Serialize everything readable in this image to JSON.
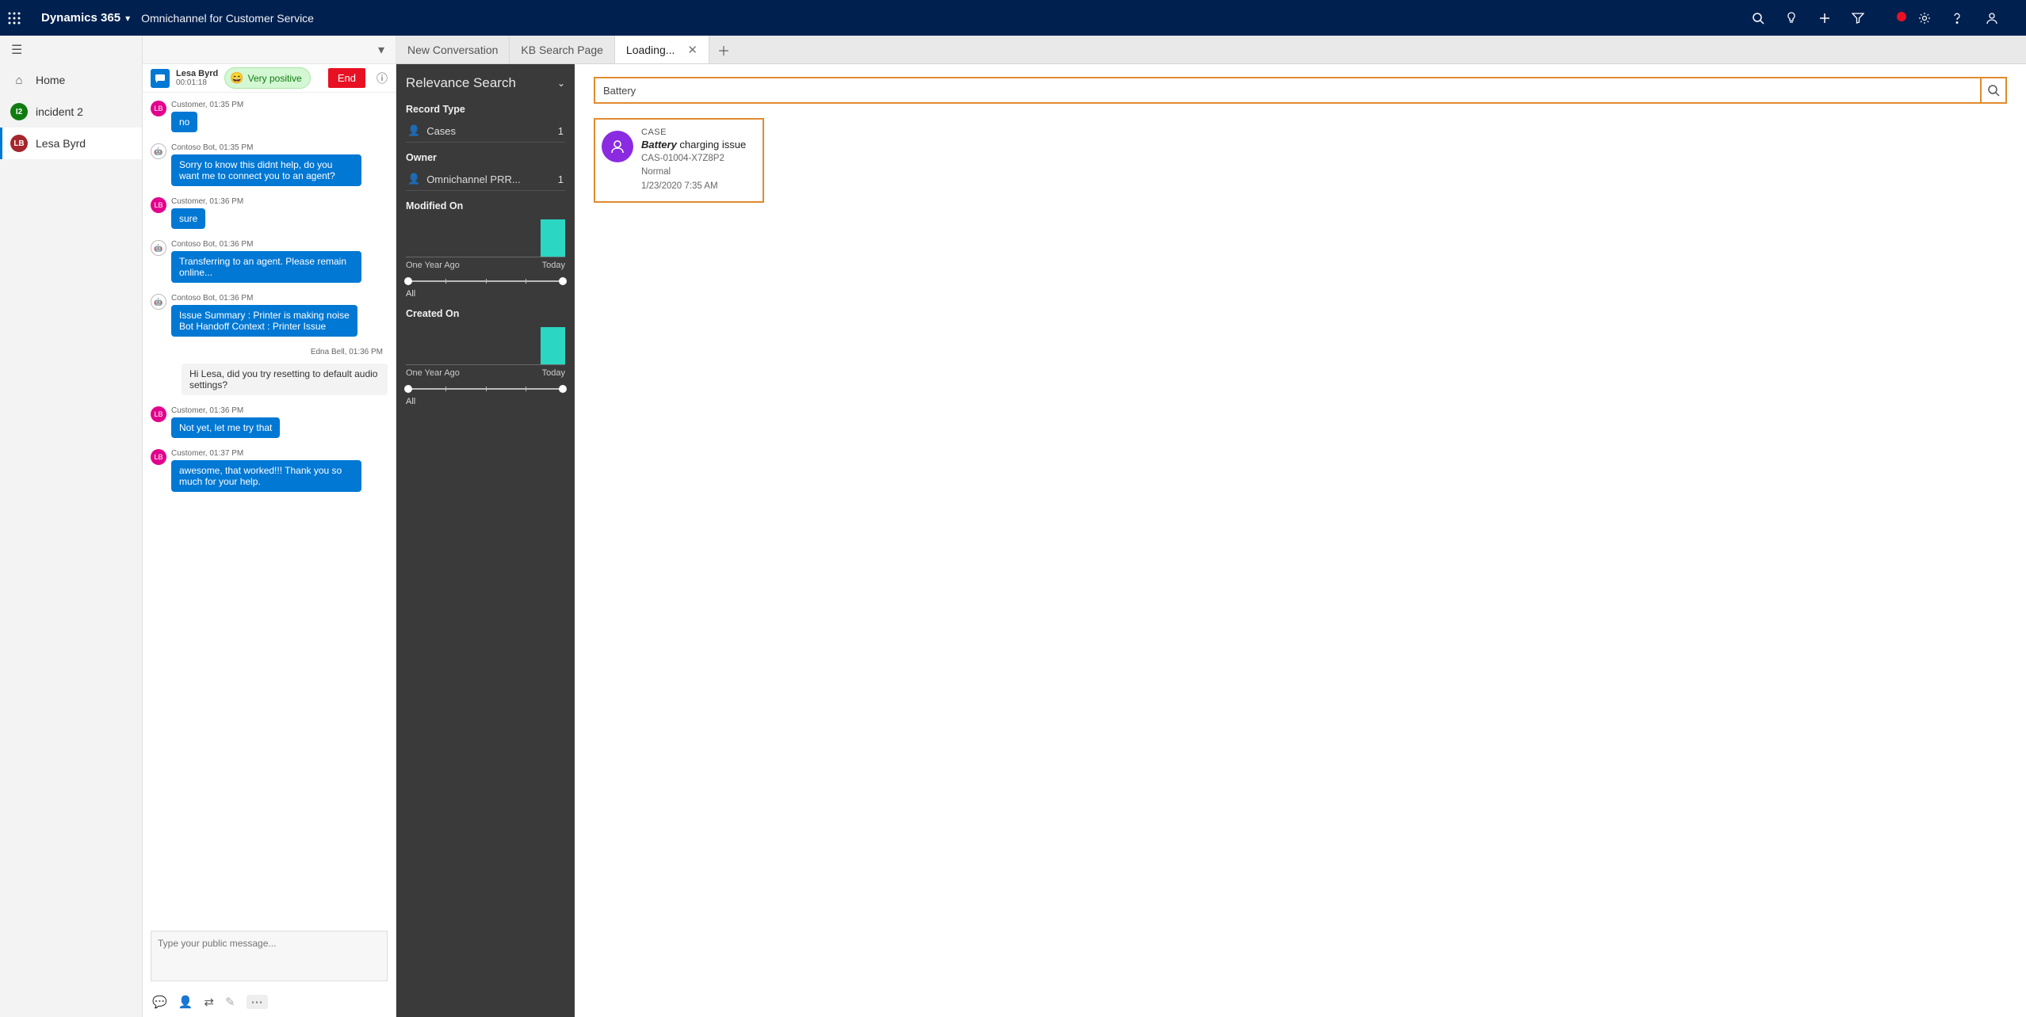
{
  "chart_data": [
    {
      "type": "bar",
      "title": "Modified On",
      "categories": [
        "",
        "",
        "",
        "",
        "",
        "Today"
      ],
      "values": [
        0,
        0,
        0,
        0,
        0,
        1
      ],
      "xmin_label": "One Year Ago",
      "xmax_label": "Today"
    },
    {
      "type": "bar",
      "title": "Created On",
      "categories": [
        "",
        "",
        "",
        "",
        "",
        "Today"
      ],
      "values": [
        0,
        0,
        0,
        0,
        0,
        1
      ],
      "xmin_label": "One Year Ago",
      "xmax_label": "Today"
    }
  ],
  "topnav": {
    "app": "Dynamics 365",
    "sub_app": "Omnichannel for Customer Service"
  },
  "leftrail": {
    "home": "Home",
    "items": [
      {
        "badge": "I2",
        "label": "incident 2"
      },
      {
        "badge": "LB",
        "label": "Lesa Byrd"
      }
    ]
  },
  "tabs": {
    "t1": "New Conversation",
    "t2": "KB Search Page",
    "t3": "Loading..."
  },
  "session": {
    "customer_name": "Lesa Byrd",
    "duration": "00:01:18",
    "sentiment": "Very positive",
    "end": "End",
    "compose_placeholder": "Type your public message...",
    "messages": [
      {
        "who": "customer",
        "meta": "Customer, 01:35 PM",
        "text": "no"
      },
      {
        "who": "bot",
        "meta": "Contoso Bot, 01:35 PM",
        "text": "Sorry to know this didnt help, do you want me to connect you to an agent?"
      },
      {
        "who": "customer",
        "meta": "Customer, 01:36 PM",
        "text": "sure"
      },
      {
        "who": "bot",
        "meta": "Contoso Bot, 01:36 PM",
        "text": "Transferring to an agent. Please remain online..."
      },
      {
        "who": "bot",
        "meta": "Contoso Bot, 01:36 PM",
        "text": "Issue Summary : Printer is making noise\nBot Handoff Context : Printer Issue"
      },
      {
        "who": "agent",
        "meta": "Edna Bell,  01:36 PM",
        "text": "Hi Lesa, did you try resetting to default audio settings?"
      },
      {
        "who": "customer",
        "meta": "Customer, 01:36 PM",
        "text": "Not yet, let me try that"
      },
      {
        "who": "customer",
        "meta": "Customer, 01:37 PM",
        "text": "awesome, that worked!!! Thank you so much for your help."
      }
    ]
  },
  "relevance": {
    "title": "Relevance Search",
    "record_type": "Record Type",
    "facets": {
      "cases_label": "Cases",
      "cases_count": "1",
      "owner_label": "Omnichannel PRR...",
      "owner_count": "1"
    },
    "owner_heading": "Owner",
    "modified_heading": "Modified On",
    "created_heading": "Created On",
    "axis_from": "One Year Ago",
    "axis_to": "Today",
    "all": "All"
  },
  "search": {
    "value": "Battery"
  },
  "result": {
    "type": "CASE",
    "title_hl": "Battery",
    "title_rest": " charging issue",
    "ref": "CAS-01004-X7Z8P2",
    "priority": "Normal",
    "date": "1/23/2020 7:35 AM"
  }
}
